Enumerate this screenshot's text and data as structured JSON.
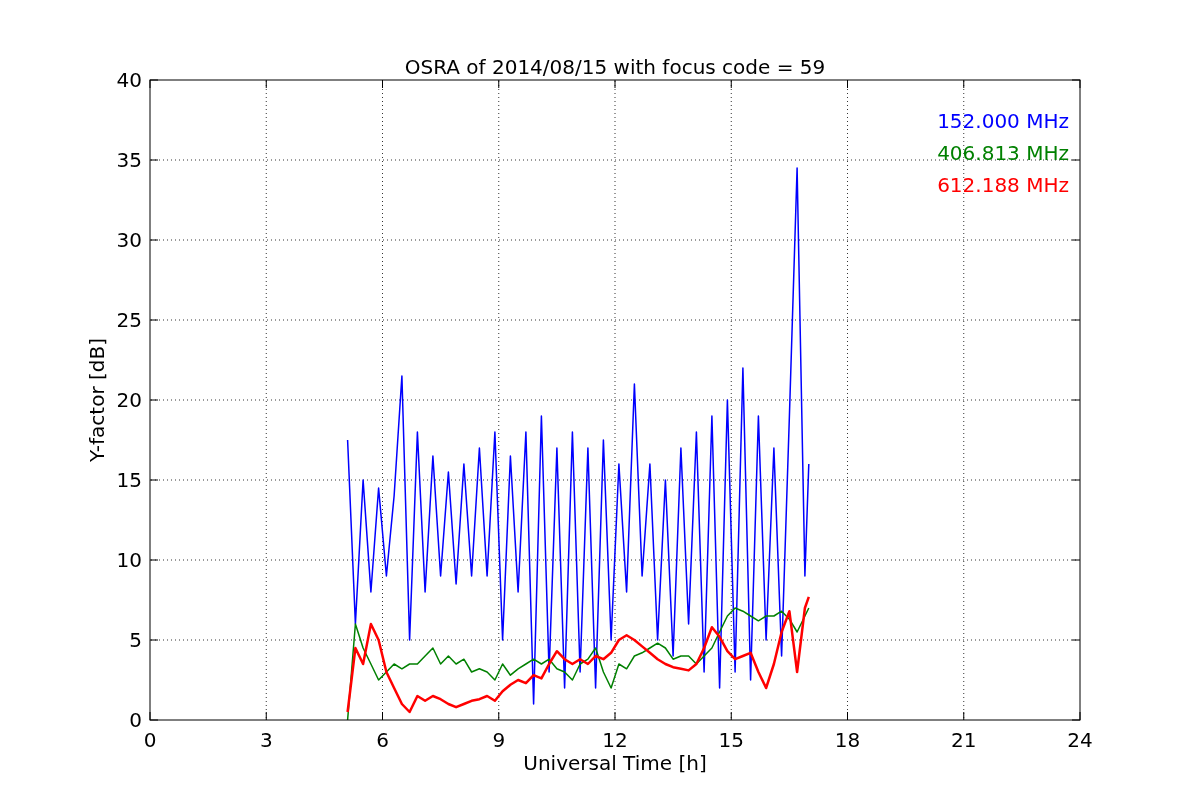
{
  "figure": {
    "chart_data": {
      "type": "line",
      "title": "OSRA of 2014/08/15 with focus code = 59",
      "xlabel": "Universal Time [h]",
      "ylabel": "Y-factor [dB]",
      "x": [
        5.1,
        5.3,
        5.5,
        5.7,
        5.9,
        6.1,
        6.3,
        6.5,
        6.7,
        6.9,
        7.1,
        7.3,
        7.5,
        7.7,
        7.9,
        8.1,
        8.3,
        8.5,
        8.7,
        8.9,
        9.1,
        9.3,
        9.5,
        9.7,
        9.9,
        10.1,
        10.3,
        10.5,
        10.7,
        10.9,
        11.1,
        11.3,
        11.5,
        11.7,
        11.9,
        12.1,
        12.3,
        12.5,
        12.7,
        12.9,
        13.1,
        13.3,
        13.5,
        13.7,
        13.9,
        14.1,
        14.3,
        14.5,
        14.7,
        14.9,
        15.1,
        15.3,
        15.5,
        15.7,
        15.9,
        16.1,
        16.3,
        16.5,
        16.7,
        16.9,
        17.0
      ],
      "series": [
        {
          "name": "152.000 MHz",
          "color": "#0000ff",
          "values": [
            17.5,
            6,
            15,
            8,
            14.5,
            9,
            14,
            21.5,
            5,
            18,
            8,
            16.5,
            9,
            15.5,
            8.5,
            16,
            9,
            17,
            9,
            18,
            5,
            16.5,
            8,
            18,
            1,
            19,
            3,
            17,
            2,
            18,
            3,
            17,
            2,
            17.5,
            5,
            16,
            8,
            21,
            9,
            16,
            5,
            15,
            4,
            17,
            6,
            18,
            3,
            19,
            2,
            20,
            3,
            22,
            2.5,
            19,
            5,
            17,
            4,
            19,
            34.5,
            9,
            16
          ]
        },
        {
          "name": "406.813 MHz",
          "color": "#008000",
          "values": [
            0,
            6,
            4.5,
            3.5,
            2.5,
            3,
            3.5,
            3.2,
            3.5,
            3.5,
            4,
            4.5,
            3.5,
            4,
            3.5,
            3.8,
            3,
            3.2,
            3,
            2.5,
            3.5,
            2.8,
            3.2,
            3.5,
            3.8,
            3.5,
            3.8,
            3.2,
            3,
            2.5,
            3.5,
            3.8,
            4.5,
            3,
            2,
            3.5,
            3.2,
            4,
            4.2,
            4.5,
            4.8,
            4.5,
            3.8,
            4,
            4,
            3.5,
            4,
            4.5,
            5.5,
            6.5,
            7,
            6.8,
            6.5,
            6.2,
            6.5,
            6.5,
            6.8,
            6.3,
            5.5,
            6.5,
            7
          ]
        },
        {
          "name": "612.188 MHz",
          "color": "#ff0000",
          "values": [
            0.5,
            4.5,
            3.5,
            6,
            5,
            3,
            2,
            1,
            0.5,
            1.5,
            1.2,
            1.5,
            1.3,
            1,
            0.8,
            1,
            1.2,
            1.3,
            1.5,
            1.2,
            1.8,
            2.2,
            2.5,
            2.3,
            2.8,
            2.6,
            3.5,
            4.3,
            3.8,
            3.5,
            3.8,
            3.5,
            4,
            3.8,
            4.2,
            5,
            5.3,
            5,
            4.6,
            4.2,
            3.8,
            3.5,
            3.3,
            3.2,
            3.1,
            3.5,
            4.5,
            5.8,
            5.2,
            4.3,
            3.8,
            4,
            4.2,
            3,
            2,
            3.5,
            5.5,
            6.8,
            3,
            7,
            7.7
          ]
        }
      ],
      "grid": true,
      "xlim": [
        0,
        24
      ],
      "ylim": [
        0,
        40
      ],
      "xticks": [
        0,
        3,
        6,
        9,
        12,
        15,
        18,
        21,
        24
      ],
      "yticks": [
        0,
        5,
        10,
        15,
        20,
        25,
        30,
        35,
        40
      ]
    }
  }
}
